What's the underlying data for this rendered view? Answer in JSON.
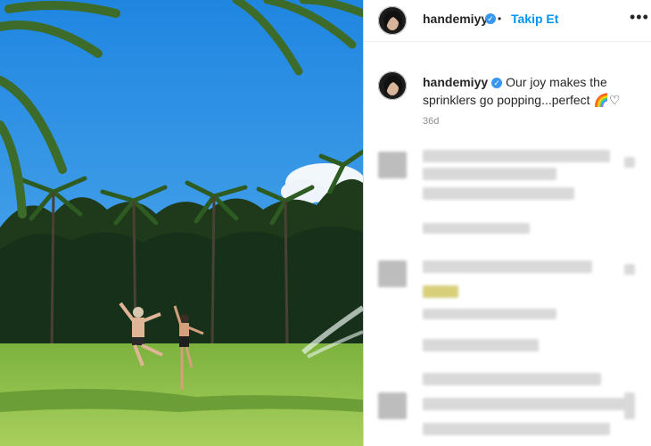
{
  "header": {
    "username": "handemiyy",
    "separator": "•",
    "follow_label": "Takip Et",
    "more_glyph": "•••"
  },
  "caption": {
    "username": "handemiyy",
    "text": "Our joy makes the sprinklers go popping...perfect",
    "emoji": "🌈",
    "heart_glyph": "♡"
  },
  "timestamp": "36d",
  "icons": {
    "verified": "verified-badge-icon",
    "more": "more-options-icon",
    "heart": "heart-icon"
  },
  "colors": {
    "link_blue": "#0095f6",
    "verified_blue": "#3897f0",
    "sky": "#2f8fe3",
    "grass": "#8dc34c"
  }
}
